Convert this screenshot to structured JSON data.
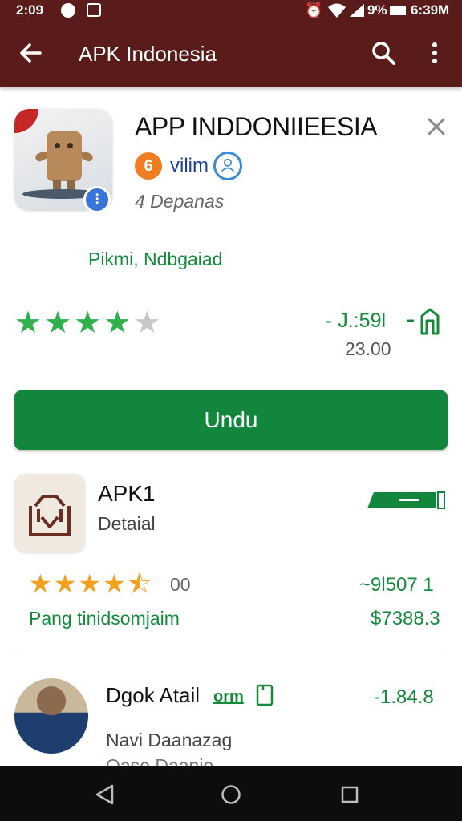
{
  "status_bar": {
    "time": "2:09",
    "battery_text": "9%",
    "clock_right": "6:39M"
  },
  "app_bar": {
    "title": "APK Indonesia",
    "icons": [
      "back-arrow-icon",
      "search-icon",
      "more-vert-icon"
    ]
  },
  "hero": {
    "title": "APP INDDONIIEESIA",
    "developer": "vilim",
    "dev_initial": "6",
    "subtitle": "4 Depanas",
    "badge_glyph": "⫶",
    "link_text": "Pikmi, Ndbgaiad",
    "rating_stars": 4,
    "size_value": "- J.:59l",
    "count_value": "23.00",
    "install_label": "Undu"
  },
  "card": {
    "title": "APK1",
    "subtitle": "Detaial",
    "rating_stars": 4.5,
    "rating_text": "00",
    "price_top": "~9l507 1",
    "caption": "Pang tinidsomjaim",
    "price_bottom": "$7388.3"
  },
  "person": {
    "title": "Dgok Atail",
    "tag": "orm",
    "price": "-1.84.8",
    "subtitle": "Navi Daanazag",
    "subtitle2": "Oase Daanie"
  },
  "colors": {
    "app_bar": "#5a1c1a",
    "accent_green": "#13863d",
    "star_green": "#2fb24c",
    "star_orange": "#f2a11f"
  }
}
